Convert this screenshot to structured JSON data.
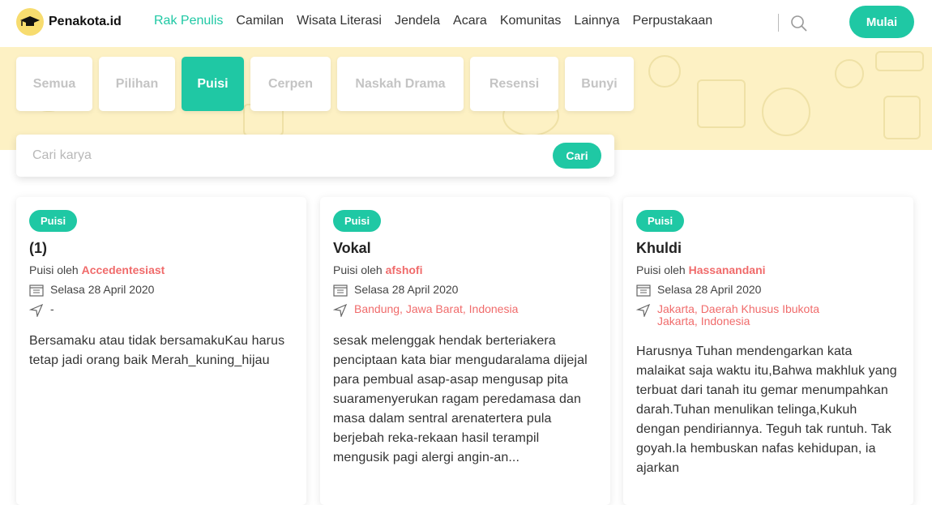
{
  "header": {
    "logo_text": "Penakota.id",
    "nav": [
      "Rak Penulis",
      "Camilan",
      "Wisata Literasi",
      "Jendela",
      "Acara",
      "Komunitas",
      "Lainnya",
      "Perpustakaan"
    ],
    "active_nav": "Rak Penulis",
    "cta_label": "Mulai"
  },
  "tabs": [
    {
      "label": "Semua",
      "active": false
    },
    {
      "label": "Pilihan",
      "active": false
    },
    {
      "label": "Puisi",
      "active": true
    },
    {
      "label": "Cerpen",
      "active": false
    },
    {
      "label": "Naskah Drama",
      "active": false
    },
    {
      "label": "Resensi",
      "active": false
    },
    {
      "label": "Bunyi",
      "active": false
    }
  ],
  "search": {
    "placeholder": "Cari karya",
    "button_label": "Cari"
  },
  "cards": [
    {
      "badge": "Puisi",
      "title": "(1)",
      "author_prefix": "Puisi oleh",
      "author": "Accedentesiast",
      "date": "Selasa 28 April 2020",
      "location": "-",
      "excerpt": "Bersamaku atau tidak bersamakuKau harus tetap jadi orang baik Merah_kuning_hijau"
    },
    {
      "badge": "Puisi",
      "title": "Vokal",
      "author_prefix": "Puisi oleh",
      "author": "afshofi",
      "date": "Selasa 28 April 2020",
      "location": "Bandung, Jawa Barat, Indonesia",
      "excerpt": "sesak melenggak hendak berteriakera penciptaan kata biar mengudaralama dijejal para pembual asap-asap mengusap pita suaramenyerukan ragam peredamasa dan masa dalam sentral arenatertera pula berjebah reka-rekaan hasil terampil mengusik pagi alergi angin-an..."
    },
    {
      "badge": "Puisi",
      "title": "Khuldi",
      "author_prefix": "Puisi oleh",
      "author": "Hassanandani",
      "date": "Selasa 28 April 2020",
      "location": "Jakarta, Daerah Khusus Ibukota Jakarta, Indonesia",
      "excerpt": "Harusnya Tuhan mendengarkan kata malaikat saja waktu itu,Bahwa makhluk yang terbuat dari tanah itu gemar menumpahkan darah.Tuhan menulikan telinga,Kukuh dengan pendiriannya. Teguh tak runtuh. Tak goyah.Ia hembuskan nafas kehidupan, ia ajarkan"
    }
  ],
  "colors": {
    "accent": "#1fc8a4",
    "author": "#f06b6b",
    "banner": "#fdf1c4"
  }
}
